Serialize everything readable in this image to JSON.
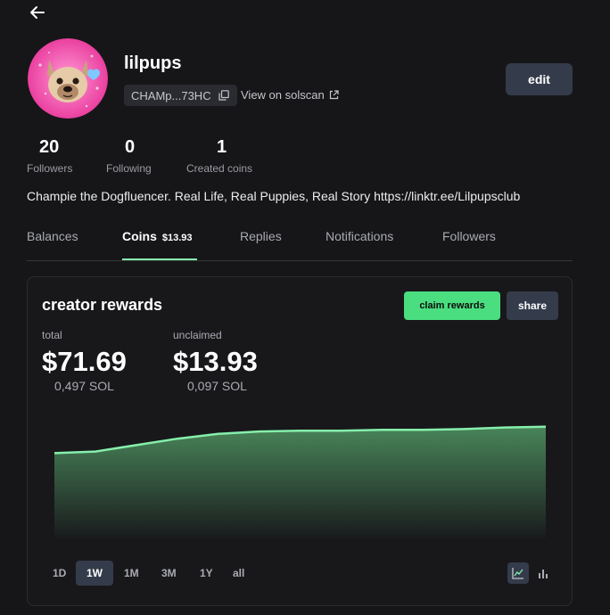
{
  "profile": {
    "username": "lilpups",
    "address_short": "CHAMp...73HC",
    "solscan_label": "View on solscan",
    "edit_label": "edit",
    "bio": "Champie the Dogfluencer. Real Life, Real Puppies, Real Story https://linktr.ee/Lilpupsclub"
  },
  "stats": [
    {
      "value": "20",
      "label": "Followers"
    },
    {
      "value": "0",
      "label": "Following"
    },
    {
      "value": "1",
      "label": "Created coins"
    }
  ],
  "tabs": [
    {
      "label": "Balances"
    },
    {
      "label": "Coins",
      "badge": "$13.93",
      "active": true
    },
    {
      "label": "Replies"
    },
    {
      "label": "Notifications"
    },
    {
      "label": "Followers"
    }
  ],
  "rewards": {
    "title": "creator rewards",
    "claim_label": "claim rewards",
    "share_label": "share",
    "total_label": "total",
    "total_value": "$71.69",
    "total_sol": "0,497 SOL",
    "unclaimed_label": "unclaimed",
    "unclaimed_value": "$13.93",
    "unclaimed_sol": "0,097 SOL"
  },
  "ranges": [
    "1D",
    "1W",
    "1M",
    "3M",
    "1Y",
    "all"
  ],
  "active_range": "1W",
  "colors": {
    "accent_green": "#4ade80",
    "line_green": "#86efac",
    "button_slate": "#343c4b",
    "background": "#161618"
  },
  "icons": {
    "back": "arrow-left-icon",
    "copy": "copy-icon",
    "external": "external-link-icon",
    "line_chart": "line-chart-icon",
    "bar_chart": "bar-chart-icon"
  },
  "chart_data": {
    "type": "area",
    "x": [
      0,
      1,
      2,
      3,
      4,
      5,
      6,
      7,
      8,
      9,
      10,
      11,
      12
    ],
    "values": [
      0.82,
      0.83,
      0.87,
      0.91,
      0.94,
      0.955,
      0.96,
      0.96,
      0.965,
      0.965,
      0.97,
      0.98,
      0.985
    ],
    "xlabel": "",
    "ylabel": "",
    "grid": false
  }
}
